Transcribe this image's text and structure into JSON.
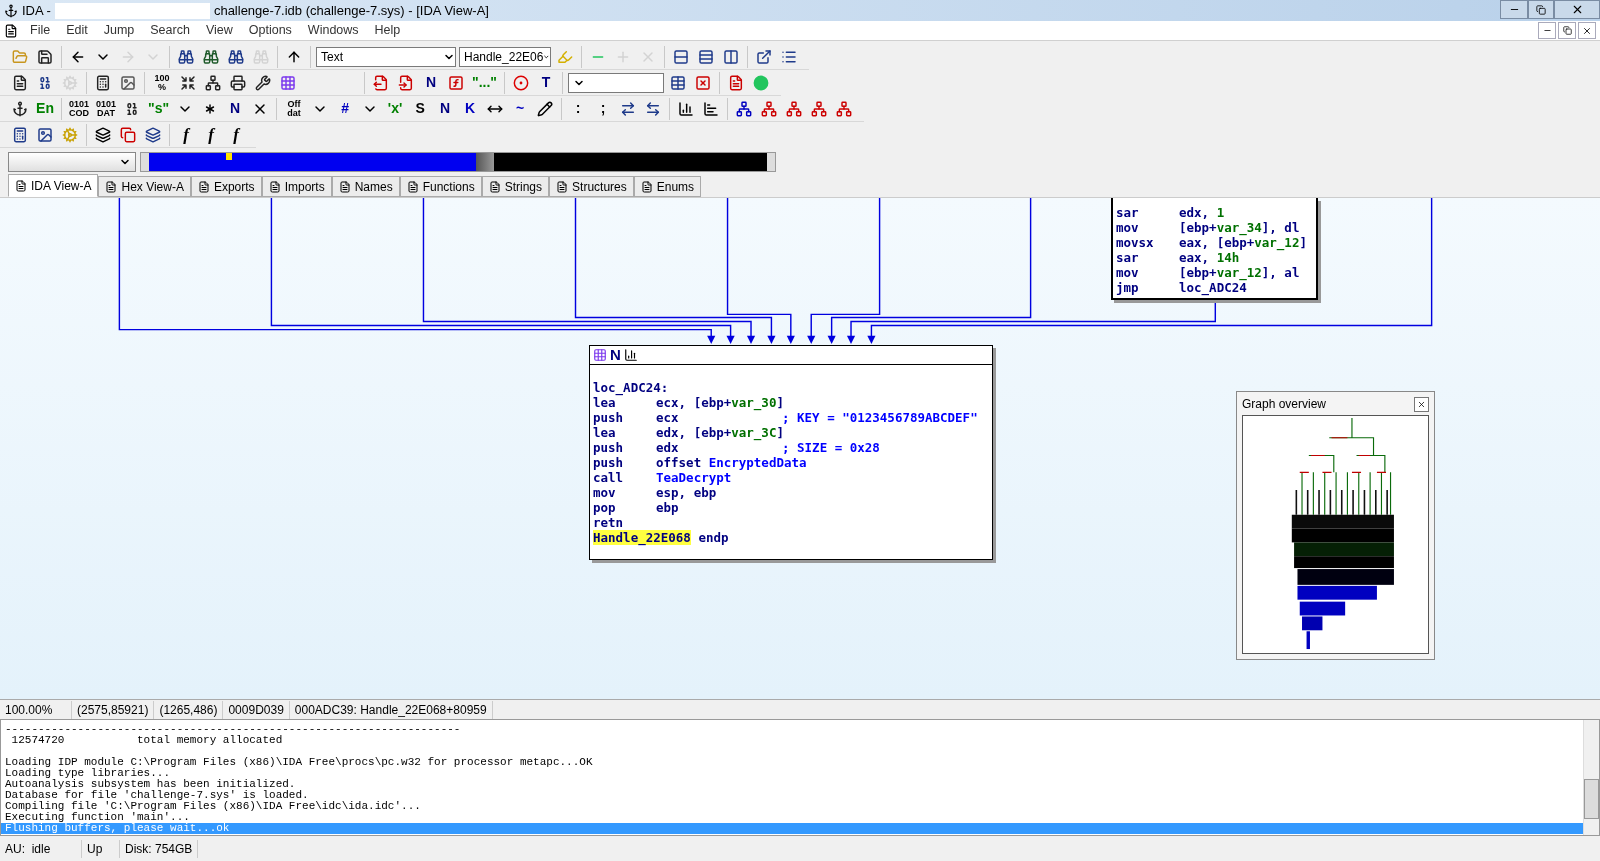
{
  "window": {
    "app": "IDA -",
    "title": "challenge-7.idb (challenge-7.sys) - [IDA View-A]"
  },
  "menu": [
    "File",
    "Edit",
    "Jump",
    "Search",
    "View",
    "Options",
    "Windows",
    "Help"
  ],
  "toolbars": [
    [
      [
        {
          "kind": "icon",
          "disabled": false
        },
        {
          "kind": "icon",
          "disabled": false
        }
      ],
      [
        {
          "kind": "icon",
          "disabled": false
        },
        {
          "kind": "icon",
          "disabled": false
        },
        {
          "kind": "icon",
          "disabled": true
        },
        {
          "kind": "icon",
          "disabled": true
        }
      ],
      [
        {
          "kind": "icon",
          "disabled": false
        },
        {
          "kind": "icon",
          "disabled": false
        },
        {
          "kind": "icon",
          "disabled": false
        },
        {
          "kind": "icon",
          "disabled": true
        }
      ],
      [
        {
          "kind": "icon",
          "disabled": false
        }
      ],
      [
        {
          "kind": "combo",
          "value": "Text",
          "disabled": false
        },
        {
          "kind": "combo",
          "value": "Handle_22E06",
          "disabled": false
        },
        {
          "kind": "icon",
          "disabled": false
        }
      ],
      [
        {
          "kind": "icon",
          "disabled": false
        },
        {
          "kind": "icon",
          "disabled": true
        },
        {
          "kind": "icon",
          "disabled": true
        }
      ],
      [
        {
          "kind": "icon",
          "disabled": false
        },
        {
          "kind": "icon",
          "disabled": false
        },
        {
          "kind": "icon",
          "disabled": false
        }
      ],
      [
        {
          "kind": "icon",
          "disabled": false
        },
        {
          "kind": "icon",
          "disabled": false
        }
      ]
    ],
    [
      [
        {
          "kind": "icon",
          "disabled": false
        },
        {
          "kind": "icon",
          "disabled": false
        },
        {
          "kind": "icon",
          "disabled": true
        }
      ],
      [
        {
          "kind": "icon",
          "disabled": false
        },
        {
          "kind": "icon",
          "disabled": false
        }
      ],
      [
        {
          "kind": "glyph",
          "text": "100 %",
          "color": "#000000",
          "disabled": false
        },
        {
          "kind": "icon",
          "disabled": false
        },
        {
          "kind": "icon",
          "disabled": false
        },
        {
          "kind": "icon",
          "disabled": false
        },
        {
          "kind": "icon",
          "disabled": false
        },
        {
          "kind": "icon",
          "disabled": false
        }
      ],
      [
        {
          "kind": "icon",
          "disabled": false
        },
        {
          "kind": "icon",
          "disabled": false
        },
        {
          "kind": "glyph",
          "text": "N",
          "color": "#000080",
          "disabled": false
        },
        {
          "kind": "icon",
          "disabled": false
        },
        {
          "kind": "glyph",
          "text": "\"...\"",
          "color": "#008000",
          "disabled": false
        }
      ],
      [
        {
          "kind": "icon",
          "disabled": false
        },
        {
          "kind": "glyph",
          "text": "T",
          "color": "#000080",
          "disabled": false
        }
      ],
      [
        {
          "kind": "combo",
          "disabled": false
        },
        {
          "kind": "icon",
          "disabled": false
        },
        {
          "kind": "icon",
          "disabled": false
        }
      ],
      [
        {
          "kind": "icon",
          "disabled": false
        },
        {
          "kind": "icon",
          "disabled": false
        }
      ]
    ],
    [
      [
        {
          "kind": "icon",
          "disabled": false
        },
        {
          "kind": "glyph",
          "text": "En",
          "color": "#008000",
          "disabled": false
        }
      ],
      [
        {
          "kind": "glyph",
          "text": "0101 COD",
          "color": "#000000",
          "disabled": false
        },
        {
          "kind": "glyph",
          "text": "0101 DAT",
          "color": "#000000",
          "disabled": false
        },
        {
          "kind": "icon",
          "disabled": false
        },
        {
          "kind": "glyph",
          "text": "\"s\"",
          "color": "#008000",
          "disabled": false
        },
        {
          "kind": "icon",
          "disabled": false
        },
        {
          "kind": "icon",
          "disabled": false
        },
        {
          "kind": "glyph",
          "text": "N",
          "color": "#000080",
          "disabled": false
        },
        {
          "kind": "icon",
          "disabled": false
        }
      ],
      [
        {
          "kind": "glyph",
          "text": "Off dat",
          "color": "#000000",
          "disabled": false
        },
        {
          "kind": "icon",
          "disabled": false
        },
        {
          "kind": "glyph",
          "text": "#",
          "color": "#0000c0",
          "disabled": false
        },
        {
          "kind": "icon",
          "disabled": false
        },
        {
          "kind": "glyph",
          "text": "'x'",
          "color": "#008000",
          "disabled": false
        },
        {
          "kind": "glyph",
          "text": "S",
          "color": "#000000",
          "disabled": false
        },
        {
          "kind": "glyph",
          "text": "N",
          "color": "#000080",
          "disabled": false
        },
        {
          "kind": "glyph",
          "text": "K",
          "color": "#0000c0",
          "disabled": false
        },
        {
          "kind": "icon",
          "disabled": false
        },
        {
          "kind": "glyph",
          "text": "~",
          "color": "#0000c0",
          "disabled": false
        },
        {
          "kind": "icon",
          "disabled": false
        }
      ],
      [
        {
          "kind": "glyph",
          "text": ":",
          "color": "#000000",
          "disabled": false
        },
        {
          "kind": "glyph",
          "text": ";",
          "color": "#000000",
          "disabled": false
        },
        {
          "kind": "icon",
          "disabled": false
        },
        {
          "kind": "icon",
          "disabled": false
        }
      ],
      [
        {
          "kind": "icon",
          "disabled": false
        },
        {
          "kind": "icon",
          "disabled": false
        }
      ],
      [
        {
          "kind": "icon",
          "disabled": false
        },
        {
          "kind": "icon",
          "disabled": false
        },
        {
          "kind": "icon",
          "disabled": false
        },
        {
          "kind": "icon",
          "disabled": false
        },
        {
          "kind": "icon",
          "disabled": false
        }
      ]
    ],
    [
      [
        {
          "kind": "icon",
          "disabled": false
        },
        {
          "kind": "icon",
          "disabled": false
        },
        {
          "kind": "icon",
          "disabled": false
        }
      ],
      [
        {
          "kind": "icon",
          "disabled": false
        },
        {
          "kind": "icon",
          "disabled": false
        },
        {
          "kind": "icon",
          "disabled": false
        }
      ],
      [
        {
          "kind": "italic",
          "text": "f",
          "color": "#000000",
          "disabled": false
        },
        {
          "kind": "italic",
          "text": "f",
          "color": "#000000",
          "disabled": false
        },
        {
          "kind": "italic",
          "text": "f",
          "color": "#000000",
          "disabled": false
        }
      ]
    ]
  ],
  "tabs": [
    {
      "label": "IDA View-A",
      "selected": true
    },
    {
      "label": "Hex View-A",
      "selected": false
    },
    {
      "label": "Exports",
      "selected": false
    },
    {
      "label": "Imports",
      "selected": false
    },
    {
      "label": "Names",
      "selected": false
    },
    {
      "label": "Functions",
      "selected": false
    },
    {
      "label": "Strings",
      "selected": false
    },
    {
      "label": "Structures",
      "selected": false
    },
    {
      "label": "Enums",
      "selected": false
    }
  ],
  "graph": {
    "side_block": [
      {
        "op": "sar",
        "args": [
          {
            "text": "edx, ",
            "kind": "reg"
          },
          {
            "text": "1",
            "kind": "num"
          }
        ]
      },
      {
        "op": "mov",
        "args": [
          {
            "text": "[ebp+",
            "kind": "reg"
          },
          {
            "text": "var_34",
            "kind": "var"
          },
          {
            "text": "], dl",
            "kind": "reg"
          }
        ]
      },
      {
        "op": "movsx",
        "args": [
          {
            "text": "eax, [ebp+",
            "kind": "reg"
          },
          {
            "text": "var_12",
            "kind": "var"
          },
          {
            "text": "]",
            "kind": "reg"
          }
        ]
      },
      {
        "op": "sar",
        "args": [
          {
            "text": "eax, ",
            "kind": "reg"
          },
          {
            "text": "14h",
            "kind": "num"
          }
        ]
      },
      {
        "op": "mov",
        "args": [
          {
            "text": "[ebp+",
            "kind": "reg"
          },
          {
            "text": "var_12",
            "kind": "var"
          },
          {
            "text": "], al",
            "kind": "reg"
          }
        ]
      },
      {
        "op": "jmp",
        "args": [
          {
            "text": "loc_ADC24",
            "kind": "reg"
          }
        ]
      }
    ],
    "main_block": {
      "label": "loc_ADC24:",
      "lines": [
        {
          "op": "lea",
          "args": [
            {
              "text": "ecx, [ebp+",
              "kind": "reg"
            },
            {
              "text": "var_30",
              "kind": "var"
            },
            {
              "text": "]",
              "kind": "reg"
            }
          ]
        },
        {
          "op": "push",
          "args": [
            {
              "text": "ecx",
              "kind": "reg"
            }
          ],
          "comment": "; KEY = \"0123456789ABCDEF\""
        },
        {
          "op": "lea",
          "args": [
            {
              "text": "edx, [ebp+",
              "kind": "reg"
            },
            {
              "text": "var_3C",
              "kind": "var"
            },
            {
              "text": "]",
              "kind": "reg"
            }
          ]
        },
        {
          "op": "push",
          "args": [
            {
              "text": "edx",
              "kind": "reg"
            }
          ],
          "comment": "; SIZE = 0x28"
        },
        {
          "op": "push",
          "args": [
            {
              "text": "offset ",
              "kind": "reg"
            },
            {
              "text": "EncryptedData",
              "kind": "name"
            }
          ]
        },
        {
          "op": "call",
          "args": [
            {
              "text": "TeaDecrypt",
              "kind": "name"
            }
          ]
        },
        {
          "op": "mov",
          "args": [
            {
              "text": "esp, ebp",
              "kind": "reg"
            }
          ]
        },
        {
          "op": "pop",
          "args": [
            {
              "text": "ebp",
              "kind": "reg"
            }
          ]
        },
        {
          "op": "retn"
        }
      ],
      "end_name": "Handle_22E068",
      "end_word": "endp",
      "header_glyph": "N"
    },
    "overview": {
      "title": "Graph overview"
    }
  },
  "status": [
    "100.00%",
    "(2575,85921)",
    "(1265,486)",
    "0009D039",
    "000ADC39: Handle_22E068+80959"
  ],
  "output": [
    {
      "lines": [
        {
          "text": "---------------------------------------------------------------------",
          "selected": false
        },
        {
          "text": " 12574720           total memory allocated",
          "selected": false
        }
      ]
    },
    {
      "lines": [
        {
          "text": "Loading IDP module C:\\Program Files (x86)\\IDA Free\\procs\\pc.w32 for processor metapc...OK",
          "selected": false
        },
        {
          "text": "Loading type libraries...",
          "selected": false
        },
        {
          "text": "Autoanalysis subsystem has been initialized.",
          "selected": false
        },
        {
          "text": "Database for file 'challenge-7.sys' is loaded.",
          "selected": false
        },
        {
          "text": "Compiling file 'C:\\Program Files (x86)\\IDA Free\\idc\\ida.idc'...",
          "selected": false
        },
        {
          "text": "Executing function 'main'...",
          "selected": false
        },
        {
          "text": "Flushing buffers, please wait...ok",
          "selected": true
        }
      ]
    }
  ],
  "bottom_status": [
    "AU:  idle",
    "Up",
    "Disk: 754GB"
  ]
}
